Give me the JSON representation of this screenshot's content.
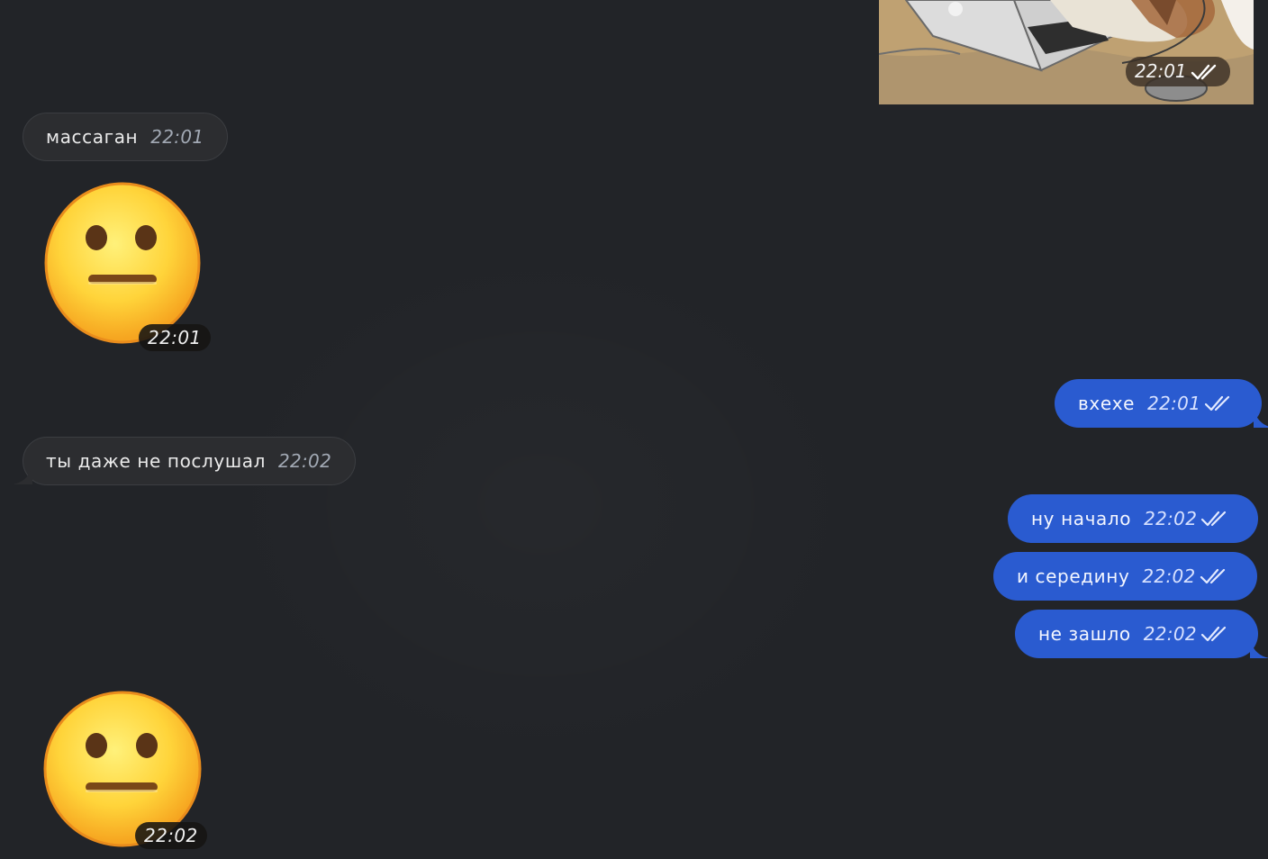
{
  "photo_message": {
    "time": "22:01"
  },
  "messages": [
    {
      "side": "in",
      "text": "массаган",
      "time": "22:01"
    },
    {
      "side": "in",
      "type": "sticker",
      "emoji": "neutral-face-icon",
      "time": "22:01"
    },
    {
      "side": "out",
      "text": "вхехе",
      "time": "22:01"
    },
    {
      "side": "in",
      "text": "ты даже не послушал",
      "time": "22:02"
    },
    {
      "side": "out",
      "text": "ну начало",
      "time": "22:02"
    },
    {
      "side": "out",
      "text": "и середину",
      "time": "22:02"
    },
    {
      "side": "out",
      "text": "не зашло",
      "time": "22:02"
    },
    {
      "side": "in",
      "type": "sticker",
      "emoji": "neutral-face-icon",
      "time": "22:02"
    }
  ],
  "colors": {
    "background": "#222428",
    "incoming_bubble": "#2c2d30",
    "outgoing_bubble": "#2a5bd0"
  }
}
